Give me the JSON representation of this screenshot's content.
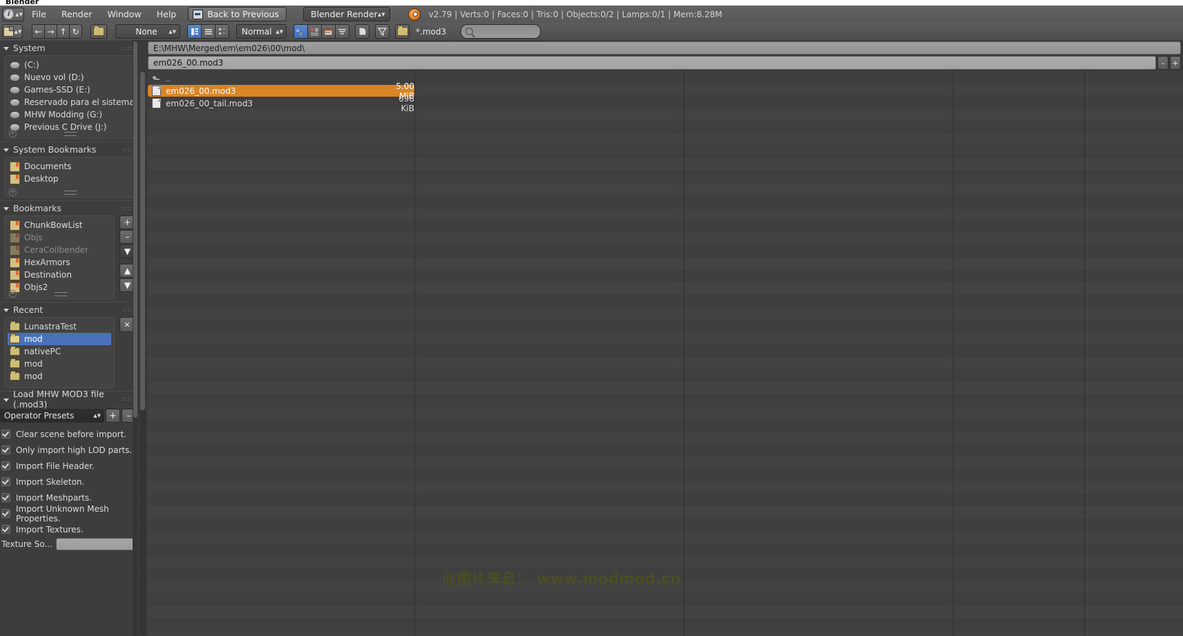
{
  "window": {
    "title": "Blender"
  },
  "menubar": {
    "editor_icon": "info-editor-icon",
    "items": [
      "File",
      "Render",
      "Window",
      "Help"
    ],
    "back_button": {
      "label": "Back to Previous",
      "icon": "back-arrow-icon"
    },
    "engine": {
      "value": "Blender Render"
    },
    "logo": "blender-logo-icon",
    "stats": "v2.79 | Verts:0 | Faces:0 | Tris:0 | Objects:0/2 | Lamps:0/1 | Mem:8.28M"
  },
  "toolbar": {
    "editor_icon": "file-browser-editor-icon",
    "nav": [
      {
        "name": "back",
        "glyph": "←"
      },
      {
        "name": "forward",
        "glyph": "→"
      },
      {
        "name": "parent",
        "glyph": "↑"
      },
      {
        "name": "refresh",
        "glyph": "↻"
      }
    ],
    "create_directory": "new-folder-icon",
    "display_mode": {
      "value": "None"
    },
    "view_buttons": [
      "thumbnail-view-icon",
      "short-list-view-icon",
      "detail-list-view-icon"
    ],
    "sort_mode": {
      "value": "Normal"
    },
    "sort_buttons": [
      "sort-alphabetical-icon",
      "sort-extension-icon",
      "sort-date-icon",
      "sort-size-icon"
    ],
    "filter_buttons": [
      "show-documents-icon",
      "filter-files-icon",
      "show-folders-icon"
    ],
    "filter_extension": "*.mod3",
    "search": {
      "placeholder": "",
      "value": "",
      "icon": "search-icon"
    }
  },
  "sidebar": {
    "sections": [
      {
        "title": "System",
        "items": [
          {
            "label": "(C:)",
            "icon": "disk-icon",
            "dim": false
          },
          {
            "label": "Nuevo vol (D:)",
            "icon": "disk-icon",
            "dim": false
          },
          {
            "label": "Games-SSD (E:)",
            "icon": "disk-icon",
            "dim": false
          },
          {
            "label": "Reservado para el sistema (F:)",
            "icon": "disk-icon",
            "dim": false
          },
          {
            "label": "MHW Modding (G:)",
            "icon": "disk-icon",
            "dim": false
          },
          {
            "label": "Previous C Drive (J:)",
            "icon": "disk-icon",
            "dim": false
          }
        ]
      },
      {
        "title": "System Bookmarks",
        "items": [
          {
            "label": "Documents",
            "icon": "bookmark-icon",
            "dim": false
          },
          {
            "label": "Desktop",
            "icon": "bookmark-icon",
            "dim": false
          }
        ]
      },
      {
        "title": "Bookmarks",
        "items": [
          {
            "label": "ChunkBowList",
            "icon": "bookmark-icon",
            "dim": false
          },
          {
            "label": "Objs",
            "icon": "bookmark-icon",
            "dim": true
          },
          {
            "label": "CeraCoilbender",
            "icon": "bookmark-icon",
            "dim": true
          },
          {
            "label": "HexArmors",
            "icon": "bookmark-icon",
            "dim": false
          },
          {
            "label": "Destination",
            "icon": "bookmark-icon",
            "dim": false
          },
          {
            "label": "Objs2",
            "icon": "bookmark-icon",
            "dim": false
          }
        ],
        "buttons": [
          "add-bookmark-button",
          "remove-bookmark-button",
          "bookmark-options-button",
          "move-up-button",
          "move-down-button"
        ]
      },
      {
        "title": "Recent",
        "items": [
          {
            "label": "LunastraTest",
            "icon": "folder-icon",
            "selected": false
          },
          {
            "label": "mod",
            "icon": "folder-icon",
            "selected": true
          },
          {
            "label": "nativePC",
            "icon": "folder-icon",
            "selected": false
          },
          {
            "label": "mod",
            "icon": "folder-icon",
            "selected": false
          },
          {
            "label": "mod",
            "icon": "folder-icon",
            "selected": false
          }
        ],
        "clear_button": "clear-recent-button"
      }
    ],
    "operator": {
      "title": "Load MHW MOD3 file (.mod3)",
      "preset": {
        "label": "Operator Presets",
        "add": "+",
        "remove": "–"
      },
      "options": [
        {
          "label": "Clear scene before import.",
          "checked": true
        },
        {
          "label": "Only import high LOD parts.",
          "checked": true
        },
        {
          "label": "Import File Header.",
          "checked": true
        },
        {
          "label": "Import Skeleton.",
          "checked": true
        },
        {
          "label": "Import Meshparts.",
          "checked": true
        },
        {
          "label": "Import Unknown Mesh Properties.",
          "checked": true
        },
        {
          "label": "Import Textures.",
          "checked": true
        }
      ],
      "texture_label": "Texture So...",
      "texture_value": ""
    }
  },
  "filebrowser": {
    "path": "E:\\MHW\\Merged\\em\\em026\\00\\mod\\",
    "filename": "em026_00.mod3",
    "increment_button": "–",
    "decrement_button": "+",
    "parent_entry": "..",
    "files": [
      {
        "name": "em026_00.mod3",
        "size": "5.00 MiB",
        "selected": true,
        "icon": "document-icon"
      },
      {
        "name": "em026_00_tail.mod3",
        "size": "698 KiB",
        "selected": false,
        "icon": "document-icon"
      }
    ]
  },
  "watermark": {
    "text": "@图片来自： www.modmod.cn"
  },
  "colors": {
    "selection_orange": "#d98427",
    "selection_blue": "#4a72b8",
    "active_toggle": "#4470b5",
    "panel_bg": "#3d3d3d",
    "watermark": "#4d5020"
  }
}
